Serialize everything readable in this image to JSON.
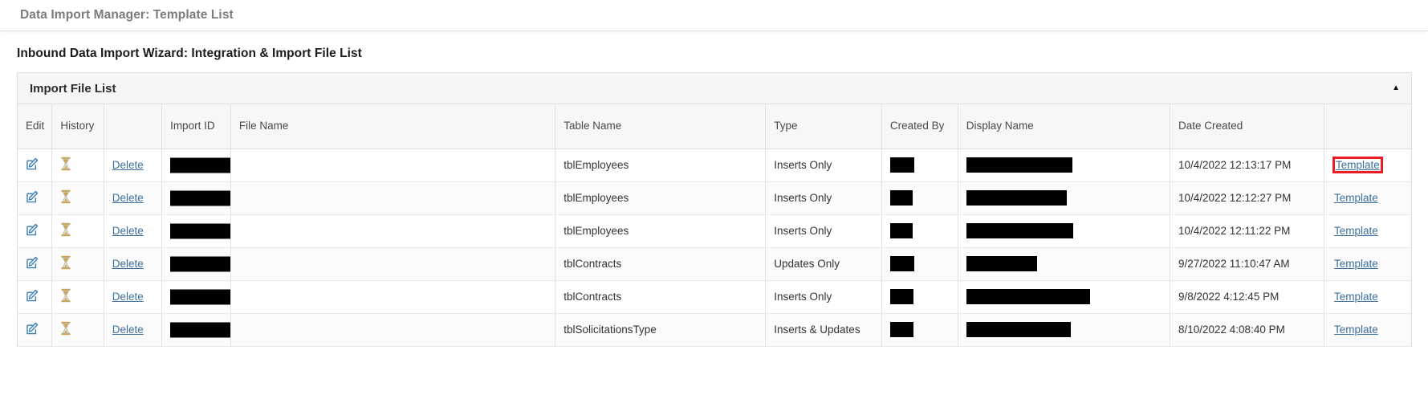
{
  "app_bar": {
    "title": "Data Import Manager: Template List"
  },
  "page": {
    "heading": "Inbound Data Import Wizard: Integration & Import File List"
  },
  "panel": {
    "title": "Import File List",
    "collapse_icon": "▲"
  },
  "colors": {
    "link": "#3c6f9e",
    "highlight_border": "#ec1c24",
    "panel_header_bg": "#f6f6f6",
    "header_text": "#4a4a4a",
    "app_title": "#7b7b7b",
    "redaction": "#000000",
    "hourglass": "#c6a24a"
  },
  "table": {
    "columns": [
      {
        "key": "edit",
        "label": "Edit"
      },
      {
        "key": "history",
        "label": "History"
      },
      {
        "key": "delete",
        "label": ""
      },
      {
        "key": "import_id",
        "label": "Import ID"
      },
      {
        "key": "file_name",
        "label": "File Name"
      },
      {
        "key": "table_name",
        "label": "Table Name"
      },
      {
        "key": "type",
        "label": "Type"
      },
      {
        "key": "created_by",
        "label": "Created By"
      },
      {
        "key": "display_name",
        "label": "Display Name"
      },
      {
        "key": "date_created",
        "label": "Date Created"
      },
      {
        "key": "template",
        "label": ""
      }
    ],
    "row_actions": {
      "edit_icon": "edit-pencil-icon",
      "history_icon": "hourglass-icon",
      "delete_label": "Delete",
      "template_label": "Template"
    },
    "rows": [
      {
        "table_name": "tblEmployees",
        "type": "Inserts Only",
        "date_created": "10/4/2022 12:13:17 PM",
        "redacted": {
          "name_width": 148,
          "created_by_width": 30,
          "display_name_width": 132
        },
        "template_highlighted": true
      },
      {
        "table_name": "tblEmployees",
        "type": "Inserts Only",
        "date_created": "10/4/2022 12:12:27 PM",
        "redacted": {
          "name_width": 133,
          "created_by_width": 28,
          "display_name_width": 125
        },
        "template_highlighted": false
      },
      {
        "table_name": "tblEmployees",
        "type": "Inserts Only",
        "date_created": "10/4/2022 12:11:22 PM",
        "redacted": {
          "name_width": 182,
          "created_by_width": 28,
          "display_name_width": 133
        },
        "template_highlighted": false
      },
      {
        "table_name": "tblContracts",
        "type": "Updates Only",
        "date_created": "9/27/2022 11:10:47 AM",
        "redacted": {
          "name_width": 206,
          "created_by_width": 30,
          "display_name_width": 88
        },
        "template_highlighted": false
      },
      {
        "table_name": "tblContracts",
        "type": "Inserts Only",
        "date_created": "9/8/2022 4:12:45 PM",
        "redacted": {
          "name_width": 248,
          "created_by_width": 29,
          "display_name_width": 154
        },
        "template_highlighted": false
      },
      {
        "table_name": "tblSolicitationsType",
        "type": "Inserts & Updates",
        "date_created": "8/10/2022 4:08:40 PM",
        "redacted": {
          "name_width": 214,
          "created_by_width": 29,
          "display_name_width": 130
        },
        "template_highlighted": false
      }
    ]
  }
}
